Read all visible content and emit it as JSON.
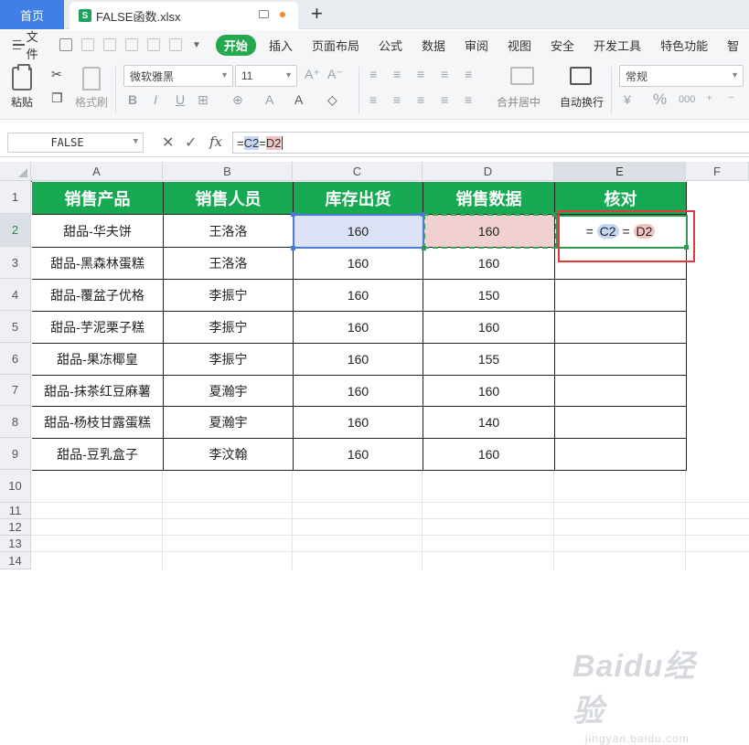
{
  "tabs": {
    "home_label": "首页",
    "file_label": "FALSE函数.xlsx",
    "file_icon": "S",
    "add_label": "+"
  },
  "menu": {
    "file_label": "文件",
    "items": [
      "开始",
      "插入",
      "页面布局",
      "公式",
      "数据",
      "审阅",
      "视图",
      "安全",
      "开发工具",
      "特色功能",
      "智"
    ],
    "active_index": 0
  },
  "ribbon": {
    "paste_label": "粘贴",
    "format_painter_label": "格式刷",
    "font_name": "微软雅黑",
    "font_size": "11",
    "merge_label": "合并居中",
    "wrap_label": "自动换行",
    "number_format": "常规",
    "percent_symbol": "%",
    "thousand_symbol": "000"
  },
  "formula_bar": {
    "name_box": "FALSE",
    "fx_label": "fx",
    "formula_prefix": "=",
    "ref1": "C2",
    "op": "=",
    "ref2": "D2"
  },
  "sheet": {
    "columns": [
      "A",
      "B",
      "C",
      "D",
      "E",
      "F"
    ],
    "rows": [
      "1",
      "2",
      "3",
      "4",
      "5",
      "6",
      "7",
      "8",
      "9",
      "10",
      "11",
      "12",
      "13",
      "14"
    ],
    "selected_column": "E",
    "selected_row": "2",
    "header": [
      "销售产品",
      "销售人员",
      "库存出货",
      "销售数据",
      "核对"
    ],
    "data": [
      [
        "甜品-华夫饼",
        "王洛洛",
        "160",
        "160"
      ],
      [
        "甜品-黑森林蛋糕",
        "王洛洛",
        "160",
        "160"
      ],
      [
        "甜品-覆盆子优格",
        "李振宁",
        "160",
        "150"
      ],
      [
        "甜品-芋泥栗子糕",
        "李振宁",
        "160",
        "160"
      ],
      [
        "甜品-果冻椰皇",
        "李振宁",
        "160",
        "155"
      ],
      [
        "甜品-抹茶红豆麻薯",
        "夏瀚宇",
        "160",
        "160"
      ],
      [
        "甜品-杨枝甘露蛋糕",
        "夏瀚宇",
        "160",
        "140"
      ],
      [
        "甜品-豆乳盒子",
        "李汶翰",
        "160",
        "160"
      ]
    ],
    "edit_cell": {
      "eq1": "=",
      "ref1": "C2",
      "eq2": "=",
      "ref2": "D2"
    }
  },
  "watermark": {
    "main": "Baidu经验",
    "sub": "jingyan.baidu.com"
  },
  "colors": {
    "header_green": "#16a951",
    "active_tab_green": "#24a94f",
    "home_tab_blue": "#3f7fe6",
    "highlight_red": "#e23a3a",
    "ref_blue": "#c5d6f4",
    "ref_red": "#f2c3c3"
  }
}
